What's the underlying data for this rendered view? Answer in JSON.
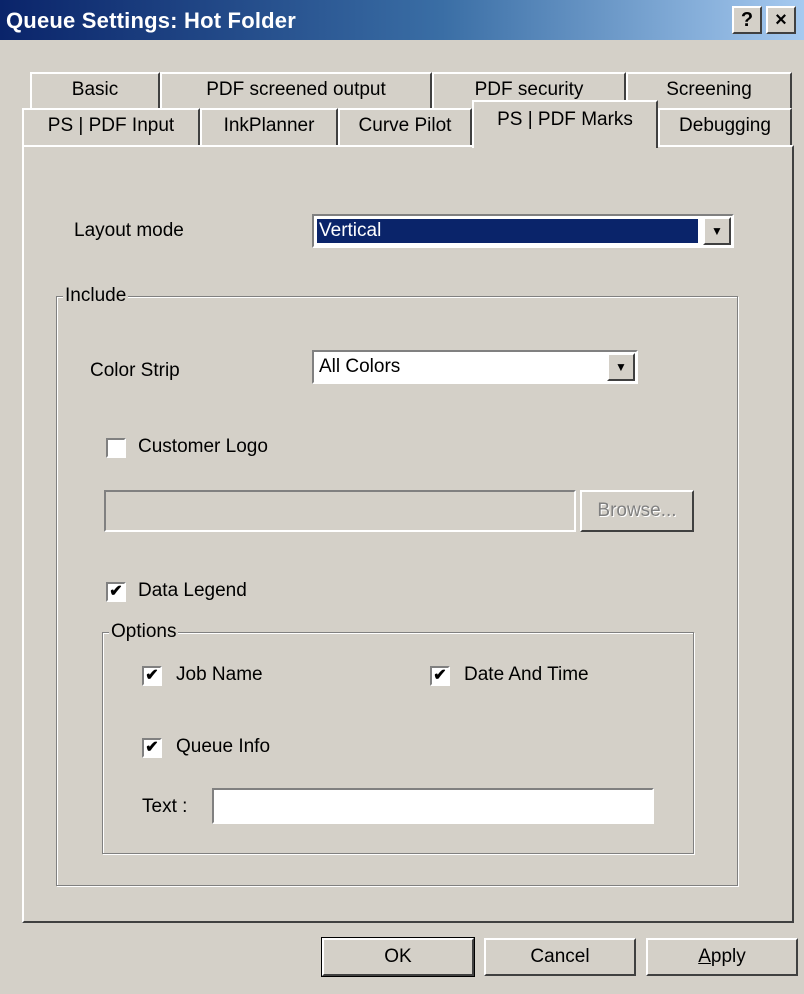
{
  "window": {
    "title": "Queue Settings: Hot Folder",
    "help_label": "?",
    "close_label": "×"
  },
  "tabs": {
    "row1": [
      "Basic",
      "PDF screened output",
      "PDF security",
      "Screening"
    ],
    "row2": [
      "PS | PDF Input",
      "InkPlanner",
      "Curve Pilot",
      "PS | PDF Marks",
      "Debugging"
    ],
    "active": "PS | PDF Marks"
  },
  "layout_mode": {
    "label": "Layout mode",
    "value": "Vertical"
  },
  "include": {
    "legend": "Include",
    "color_strip": {
      "label": "Color Strip",
      "value": "All Colors"
    },
    "customer_logo": {
      "label": "Customer Logo",
      "checked": false,
      "path_value": "",
      "browse_label": "Browse..."
    },
    "data_legend": {
      "label": "Data Legend",
      "checked": true
    },
    "options": {
      "legend": "Options",
      "job_name": {
        "label": "Job Name",
        "checked": true
      },
      "date_and_time": {
        "label": "Date And Time",
        "checked": true
      },
      "queue_info": {
        "label": "Queue Info",
        "checked": true
      },
      "text": {
        "label": "Text :",
        "value": ""
      }
    }
  },
  "buttons": {
    "ok": "OK",
    "cancel": "Cancel",
    "apply_first": "A",
    "apply_rest": "pply"
  },
  "colors": {
    "title_start": "#0a246a",
    "title_end": "#a6caf0",
    "face": "#d4d0c8",
    "selection": "#0a246a"
  },
  "icons": {
    "check": "✔",
    "dropdown": "▼"
  }
}
